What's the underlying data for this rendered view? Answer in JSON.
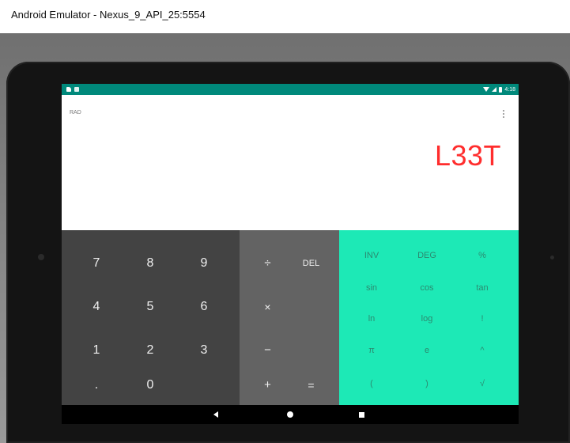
{
  "window": {
    "title": "Android Emulator - Nexus_9_API_25:5554"
  },
  "status_bar": {
    "time": "4:18"
  },
  "display": {
    "mode": "RAD",
    "result": "L33T",
    "result_color": "#ff2d2d"
  },
  "numeric_keys": [
    "7",
    "8",
    "9",
    "4",
    "5",
    "6",
    "1",
    "2",
    "3",
    ".",
    "0"
  ],
  "operator_keys": {
    "divide": "÷",
    "delete": "DEL",
    "multiply": "×",
    "minus": "−",
    "plus": "+",
    "equals": "="
  },
  "advanced_keys": [
    "INV",
    "DEG",
    "%",
    "sin",
    "cos",
    "tan",
    "ln",
    "log",
    "!",
    "π",
    "e",
    "^",
    "(",
    ")",
    "√"
  ],
  "colors": {
    "status_bar": "#00897b",
    "numeric_pad": "#434343",
    "operator_pad": "#636363",
    "advanced_pad": "#1de9b6",
    "advanced_text": "#2c8a70"
  },
  "icons": {
    "status_left": [
      "sd-card-icon",
      "app-notification-icon"
    ],
    "status_right": [
      "wifi-icon",
      "signal-icon",
      "battery-icon"
    ],
    "menu": "overflow-menu-icon",
    "nav": [
      "back-icon",
      "home-icon",
      "recents-icon"
    ]
  }
}
